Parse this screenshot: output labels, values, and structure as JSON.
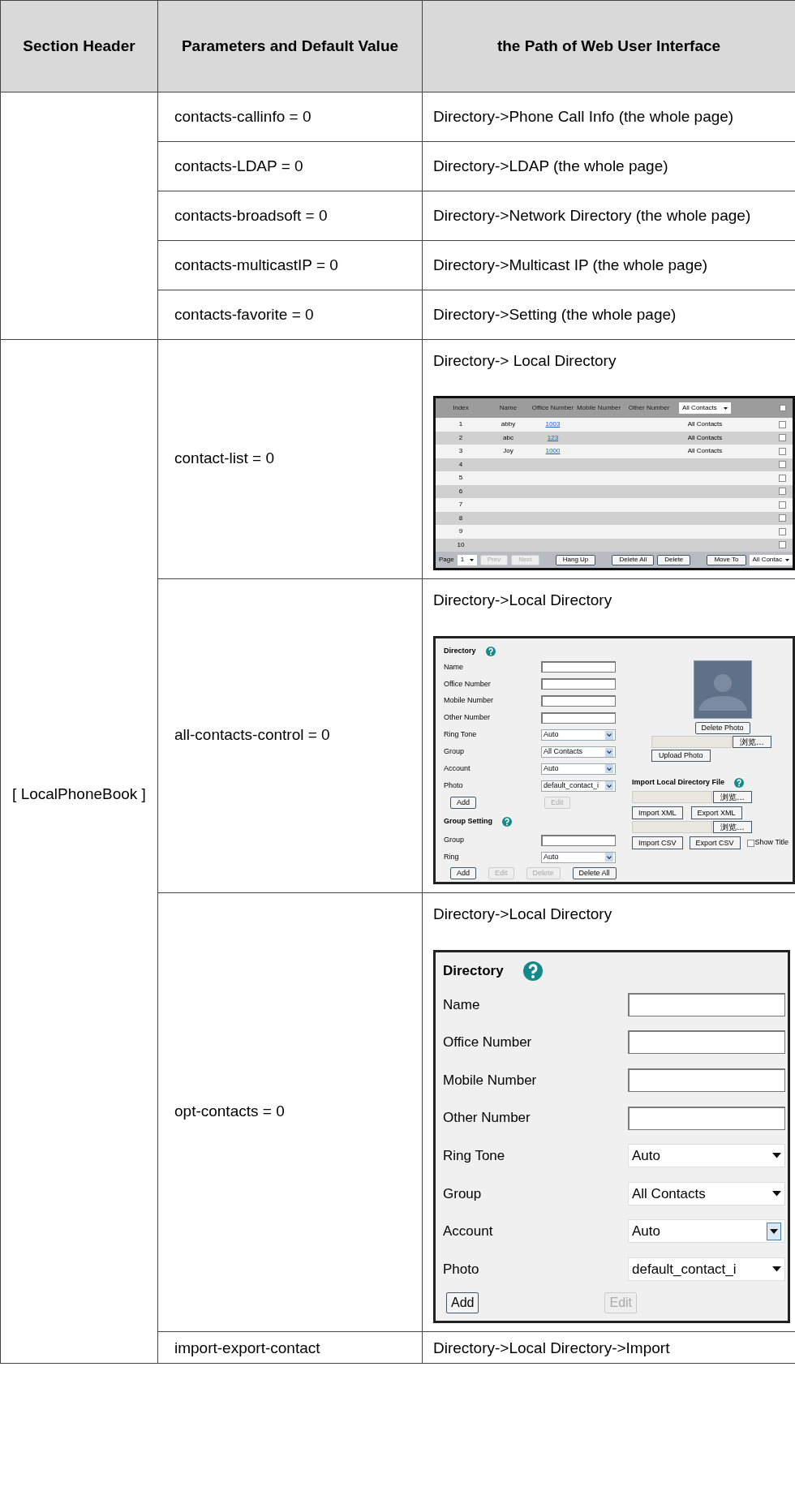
{
  "table": {
    "columns": [
      "Section Header",
      "Parameters and Default Value",
      "the Path of Web User Interface"
    ],
    "groups": [
      {
        "rows": [
          {
            "parameter": "contacts-callinfo = 0",
            "path": "Directory->Phone Call Info (the whole page)"
          },
          {
            "parameter": "contacts-LDAP = 0",
            "path": "Directory->LDAP (the whole page)"
          },
          {
            "parameter": "contacts-broadsoft = 0",
            "path": "Directory->Network Directory (the whole page)"
          },
          {
            "parameter": "contacts-multicastIP = 0",
            "path": "Directory->Multicast IP (the whole page)"
          },
          {
            "parameter": "contacts-favorite = 0",
            "path": "Directory->Setting (the whole page)"
          }
        ]
      },
      {
        "section": "[ LocalPhoneBook ]",
        "rows": [
          {
            "parameter": "contact-list = 0",
            "path": "Directory-> Local Directory",
            "screenshot": {
              "kind": "contact_list",
              "columns": [
                "Index",
                "Name",
                "Office Number",
                "Mobile Number",
                "Other Number"
              ],
              "group_filter": "All Contacts",
              "all_checked": false,
              "entries": [
                {
                  "index": "1",
                  "name": "abby",
                  "office": "1003",
                  "group": "All Contacts",
                  "checked": false
                },
                {
                  "index": "2",
                  "name": "abc",
                  "office": "123",
                  "group": "All Contacts",
                  "checked": false
                },
                {
                  "index": "3",
                  "name": "Joy",
                  "office": "1000",
                  "group": "All Contacts",
                  "checked": false
                },
                {
                  "index": "4",
                  "checked": false
                },
                {
                  "index": "5",
                  "checked": false
                },
                {
                  "index": "6",
                  "checked": false
                },
                {
                  "index": "7",
                  "checked": false
                },
                {
                  "index": "8",
                  "checked": false
                },
                {
                  "index": "9",
                  "checked": false
                },
                {
                  "index": "10",
                  "checked": false
                }
              ],
              "page_label": "Page",
              "page": "1",
              "button_groups": [
                [
                  {
                    "label": "Prev",
                    "disabled": true
                  },
                  {
                    "label": "Next",
                    "disabled": true
                  }
                ],
                [
                  {
                    "label": "Hang Up",
                    "disabled": false
                  }
                ],
                [
                  {
                    "label": "Delete All",
                    "disabled": false
                  },
                  {
                    "label": "Delete",
                    "disabled": false
                  }
                ],
                [
                  {
                    "label": "Move To",
                    "disabled": false
                  }
                ]
              ],
              "move_target": "All Contac"
            }
          },
          {
            "parameter": "all-contacts-control = 0",
            "path": "Directory->Local Directory",
            "screenshot": {
              "kind": "contact_form",
              "title": "Directory",
              "fields": [
                {
                  "label": "Name",
                  "kind": "text"
                },
                {
                  "label": "Office Number",
                  "kind": "text"
                },
                {
                  "label": "Mobile Number",
                  "kind": "text"
                },
                {
                  "label": "Other Number",
                  "kind": "text"
                },
                {
                  "label": "Ring Tone",
                  "kind": "select",
                  "value": "Auto"
                },
                {
                  "label": "Group",
                  "kind": "select",
                  "value": "All Contacts"
                },
                {
                  "label": "Account",
                  "kind": "select",
                  "value": "Auto"
                },
                {
                  "label": "Photo",
                  "kind": "select",
                  "value": "default_contact_i"
                }
              ],
              "buttons": [
                {
                  "label": "Add",
                  "disabled": false
                },
                {
                  "label": "Edit",
                  "disabled": true
                }
              ],
              "group_title": "Group Setting",
              "group_fields": [
                {
                  "label": "Group",
                  "kind": "text"
                },
                {
                  "label": "Ring",
                  "kind": "select",
                  "value": "Auto"
                }
              ],
              "group_buttons": [
                {
                  "label": "Add",
                  "disabled": false
                },
                {
                  "label": "Edit",
                  "disabled": true
                },
                {
                  "label": "Delete",
                  "disabled": true
                },
                {
                  "label": "Delete All",
                  "disabled": false
                }
              ],
              "delete_photo": "Delete Photo",
              "photo_browse": "浏览…",
              "upload_photo": "Upload Photo",
              "import_title": "Import Local Directory File",
              "imports": [
                {
                  "browse": "浏览…",
                  "buttons": [
                    "Import XML",
                    "Export XML"
                  ]
                },
                {
                  "browse": "浏览…",
                  "buttons": [
                    "Import CSV",
                    "Export CSV"
                  ],
                  "checkbox": {
                    "label": "Show Title",
                    "checked": false
                  }
                }
              ]
            }
          },
          {
            "parameter": "opt-contacts = 0",
            "path": "Directory->Local Directory",
            "screenshot": {
              "kind": "directory_form",
              "title": "Directory",
              "fields": [
                {
                  "label": "Name",
                  "kind": "text"
                },
                {
                  "label": "Office Number",
                  "kind": "text"
                },
                {
                  "label": "Mobile Number",
                  "kind": "text"
                },
                {
                  "label": "Other Number",
                  "kind": "text"
                },
                {
                  "label": "Ring Tone",
                  "kind": "select",
                  "value": "Auto",
                  "focused": false
                },
                {
                  "label": "Group",
                  "kind": "select",
                  "value": "All Contacts",
                  "focused": false
                },
                {
                  "label": "Account",
                  "kind": "select",
                  "value": "Auto",
                  "focused": true
                },
                {
                  "label": "Photo",
                  "kind": "select",
                  "value": "default_contact_i",
                  "focused": false
                }
              ],
              "buttons": [
                {
                  "label": "Add",
                  "disabled": false
                },
                {
                  "label": "Edit",
                  "disabled": true
                }
              ]
            }
          },
          {
            "parameter": "import-export-contact",
            "path": "Directory->Local Directory->Import"
          }
        ]
      }
    ]
  }
}
